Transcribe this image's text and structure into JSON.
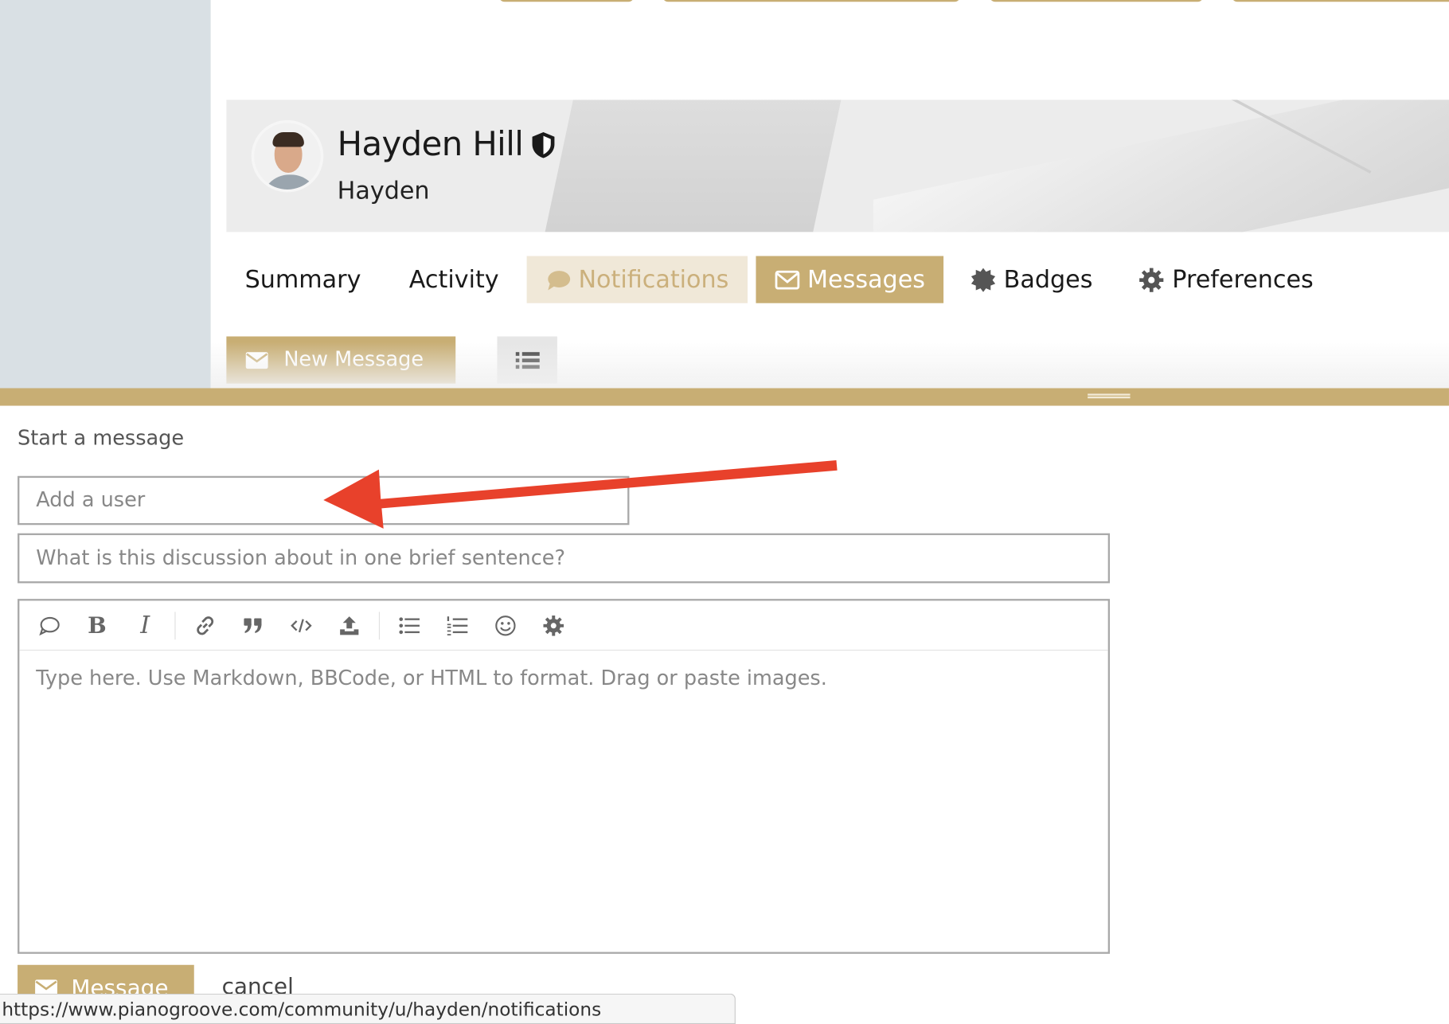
{
  "profile": {
    "full_name": "Hayden Hill",
    "username": "Hayden"
  },
  "nav": {
    "summary": "Summary",
    "activity": "Activity",
    "notifications": "Notifications",
    "messages": "Messages",
    "badges": "Badges",
    "preferences": "Preferences"
  },
  "actions": {
    "new_message": "New Message"
  },
  "composer": {
    "title": "Start a message",
    "user_placeholder": "Add a user",
    "title_placeholder": "What is this discussion about in one brief sentence?",
    "body_placeholder": "Type here. Use Markdown, BBCode, or HTML to format. Drag or paste images.",
    "submit_label": "Message",
    "cancel_label": "cancel"
  },
  "status_bar": {
    "url": "https://www.pianogroove.com/community/u/hayden/notifications"
  },
  "colors": {
    "accent": "#c8ae74",
    "accent_light": "#f0e8d8",
    "annotation_arrow": "#e8412b"
  }
}
